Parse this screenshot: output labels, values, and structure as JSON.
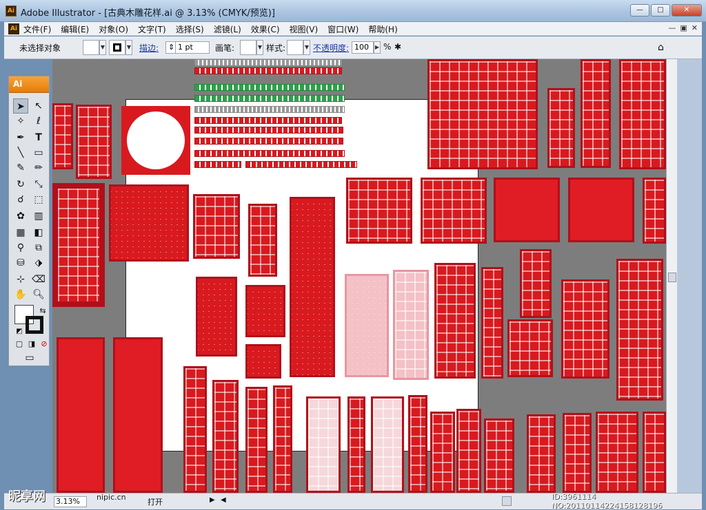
{
  "window": {
    "title": "Adobe Illustrator - [古典木雕花样.ai @ 3.13% (CMYK/预览)]",
    "app_icon": "Ai"
  },
  "menubar": {
    "items": [
      "文件(F)",
      "编辑(E)",
      "对象(O)",
      "文字(T)",
      "选择(S)",
      "滤镜(L)",
      "效果(C)",
      "视图(V)",
      "窗口(W)",
      "帮助(H)"
    ]
  },
  "control_bar": {
    "selection_status": "未选择对象",
    "stroke_label": "描边:",
    "stroke_weight": "1 pt",
    "brush_label": "画笔:",
    "style_label": "样式:",
    "opacity_label": "不透明度:",
    "opacity_value": "100",
    "opacity_unit": "%"
  },
  "toolbox": {
    "header": "Ai"
  },
  "statusbar": {
    "zoom": "3.13%",
    "status_text": "打开"
  },
  "watermark": {
    "brand": "昵享网",
    "url": "nipic.cn",
    "image_id": "ID:3961114 NO:20110114224158128196"
  },
  "colors": {
    "ornament_red": "#d81a1f",
    "accent_orange": "#e57c08",
    "canvas_gray": "#7d7d7d"
  }
}
